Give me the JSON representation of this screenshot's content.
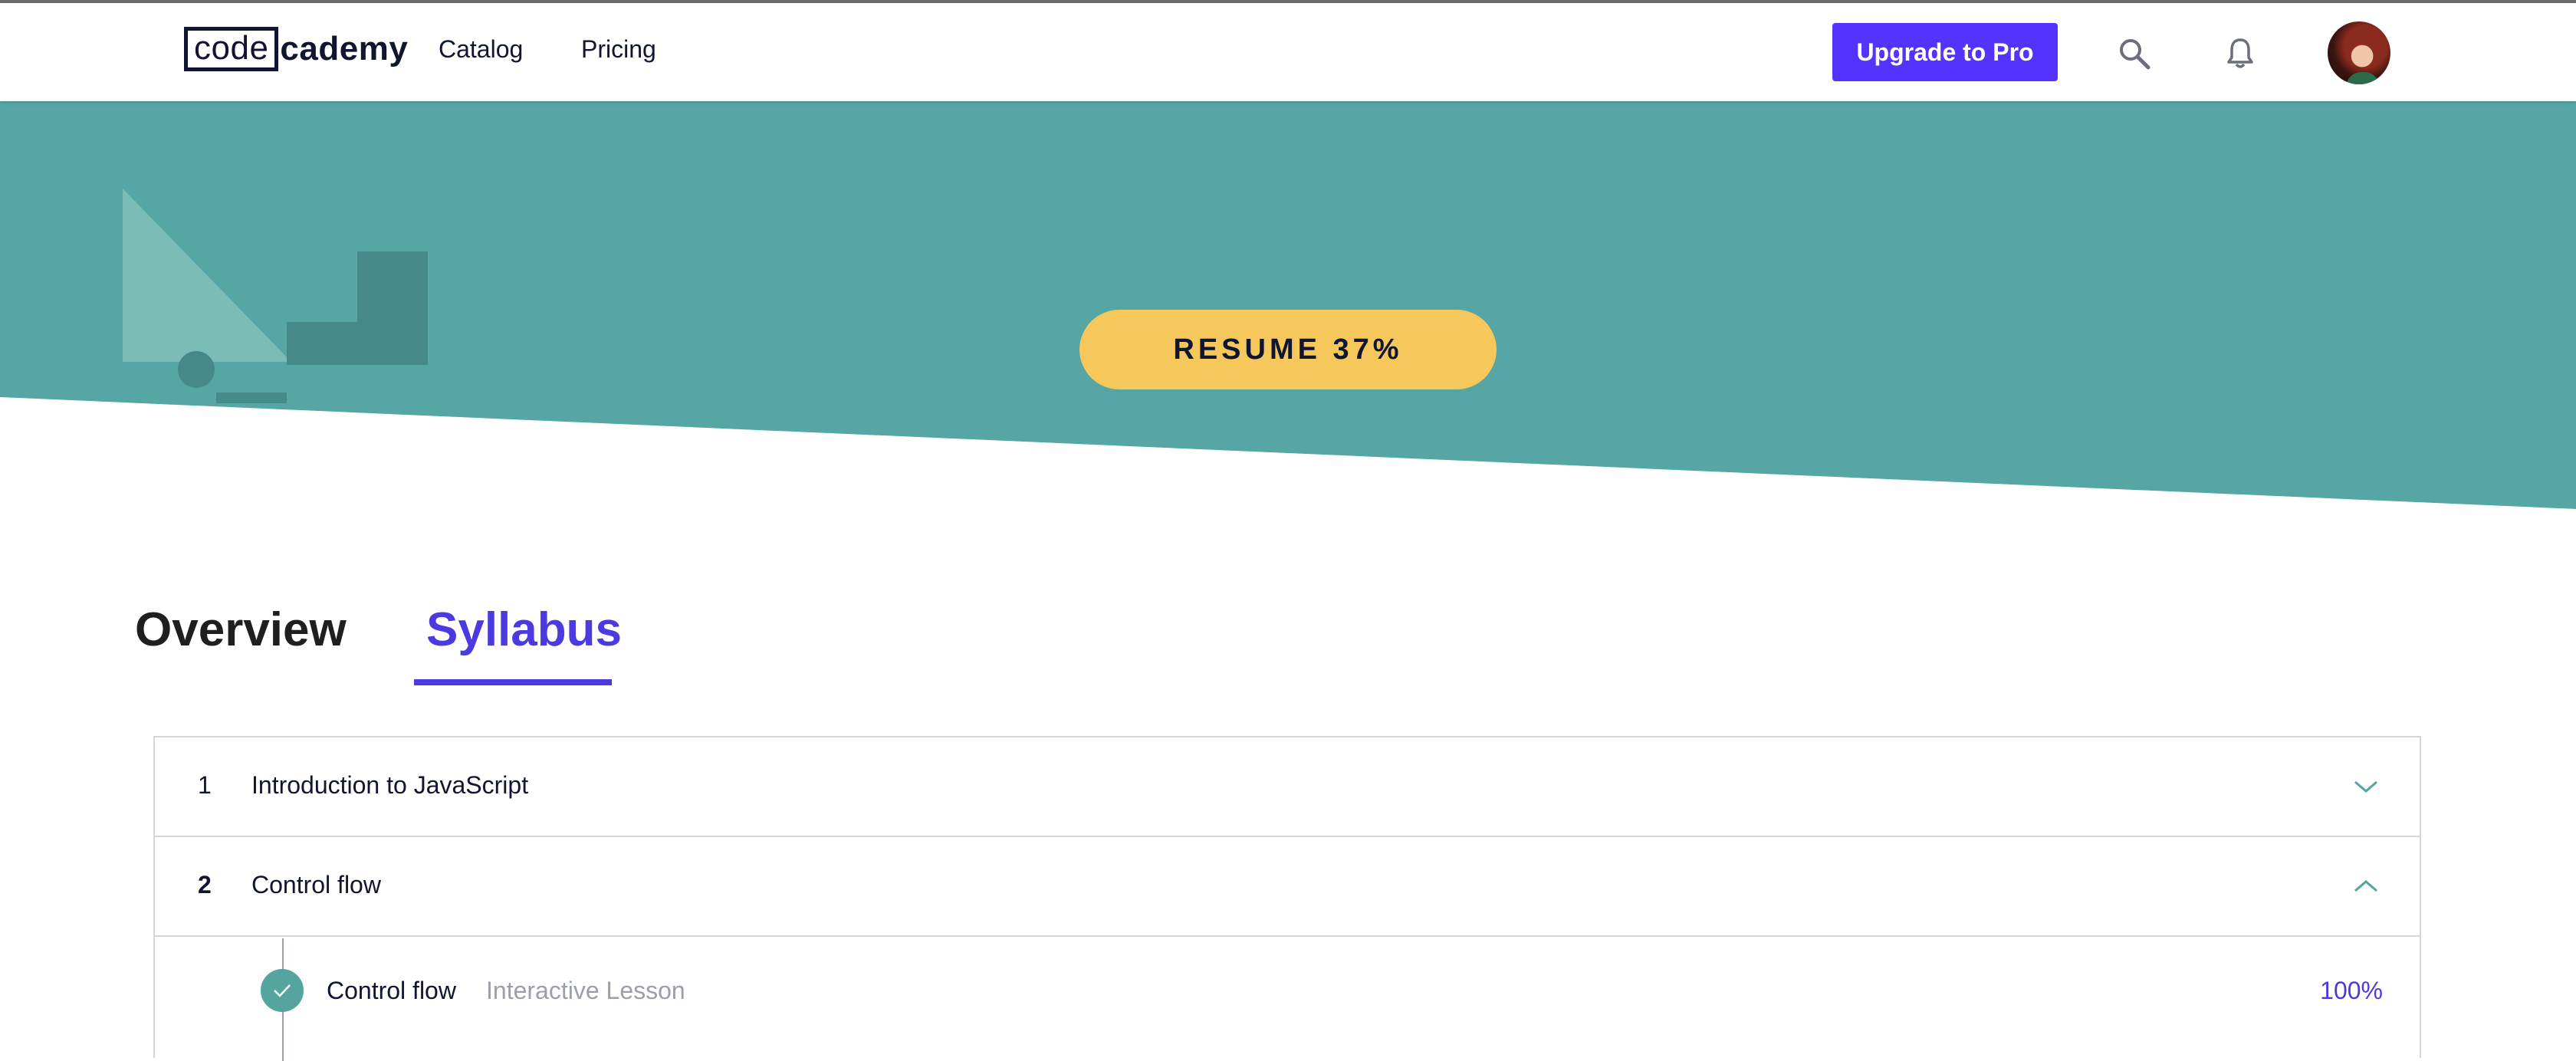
{
  "header": {
    "logo": {
      "part1": "code",
      "part2": "cademy"
    },
    "nav": [
      {
        "label": "Catalog"
      },
      {
        "label": "Pricing"
      }
    ],
    "upgrade_label": "Upgrade to Pro",
    "icons": {
      "search": "search-icon",
      "notifications": "bell-icon",
      "avatar": "user-avatar"
    }
  },
  "hero": {
    "resume_label": "RESUME 37%",
    "progress_fraction": 0.37,
    "colors": {
      "background": "#56a6a6",
      "button": "#f6c75b"
    }
  },
  "tabs": [
    {
      "label": "Overview",
      "active": false
    },
    {
      "label": "Syllabus",
      "active": true
    }
  ],
  "syllabus": {
    "modules": [
      {
        "number": "1",
        "title": "Introduction to JavaScript",
        "expanded": false
      },
      {
        "number": "2",
        "title": "Control flow",
        "expanded": true
      }
    ],
    "lessons": [
      {
        "title": "Control flow",
        "type": "Interactive Lesson",
        "progress": "100%",
        "completed": true
      }
    ]
  },
  "colors": {
    "accent": "#5533ff",
    "syllabus_accent": "#4a3ae0",
    "teal": "#56a49e",
    "text": "#10162f"
  }
}
